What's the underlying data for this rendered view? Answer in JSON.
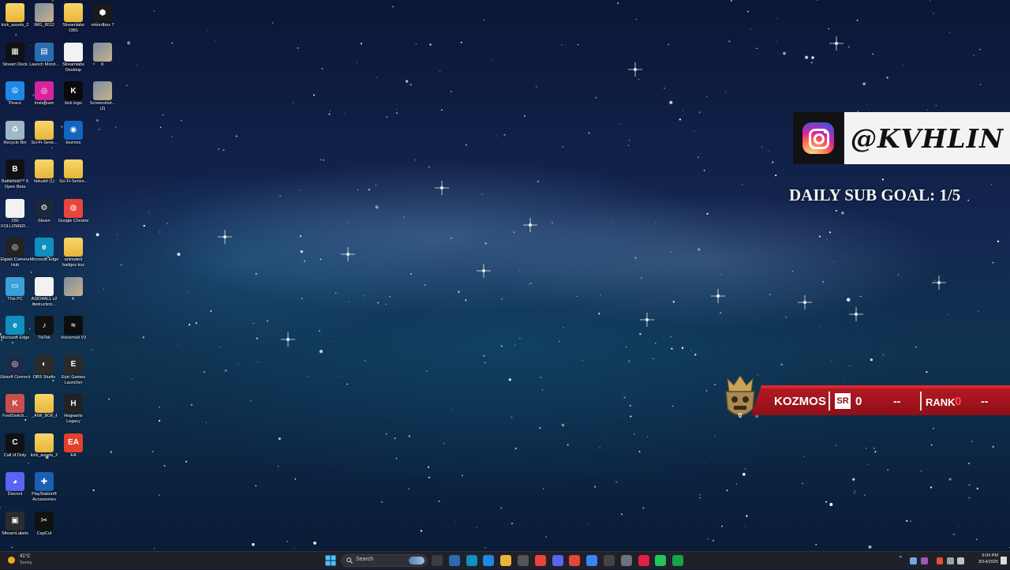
{
  "desktop_icons": [
    {
      "label": "kick_assets_2",
      "kind": "folder"
    },
    {
      "label": "IMG_8012",
      "kind": "photo"
    },
    {
      "label": "Streamlabs OBS",
      "kind": "folder"
    },
    {
      "label": "rekordbox 7",
      "kind": "app",
      "color": "#1a1a1a",
      "glyph": "⬢"
    },
    {
      "label": "Stream Deck",
      "kind": "app",
      "color": "#111",
      "glyph": "▦"
    },
    {
      "label": "Launch Monit...",
      "kind": "app",
      "color": "#2b6cb0",
      "glyph": "▤"
    },
    {
      "label": "Streamlabs Desktop",
      "kind": "file"
    },
    {
      "label": "K",
      "kind": "photo"
    },
    {
      "label": "Peace",
      "kind": "app",
      "color": "#1e88e5",
      "glyph": "☮"
    },
    {
      "label": "Instagram",
      "kind": "app",
      "color": "#d6249f",
      "glyph": "◎"
    },
    {
      "label": "kick logo",
      "kind": "app",
      "color": "#0a0a0a",
      "glyph": "K"
    },
    {
      "label": "Screenshot... (2)",
      "kind": "photo"
    },
    {
      "label": "Recycle Bin",
      "kind": "app",
      "color": "#9fb7c9",
      "glyph": "♻"
    },
    {
      "label": "Sci-Fi-Serie...",
      "kind": "folder"
    },
    {
      "label": "kozmos",
      "kind": "app",
      "color": "#1565c0",
      "glyph": "◉"
    },
    {
      "label": "",
      "kind": "none"
    },
    {
      "label": "Battlefield™ 6 Open Beta",
      "kind": "app",
      "color": "#111",
      "glyph": "B"
    },
    {
      "label": "hidusbf (1)",
      "kind": "folder"
    },
    {
      "label": "Sci-Fi-Series...",
      "kind": "folder"
    },
    {
      "label": "",
      "kind": "none"
    },
    {
      "label": "250 FOLLOWER...",
      "kind": "file"
    },
    {
      "label": "Steam",
      "kind": "app",
      "color": "#1b2838",
      "glyph": "⚙"
    },
    {
      "label": "Google Chrome",
      "kind": "app",
      "color": "#e8453c",
      "glyph": "◍"
    },
    {
      "label": "",
      "kind": "none"
    },
    {
      "label": "Elgato Camera Hub",
      "kind": "app",
      "color": "#222",
      "glyph": "◎"
    },
    {
      "label": "Microsoft Edge",
      "kind": "app",
      "color": "#0f8fbf",
      "glyph": "e"
    },
    {
      "label": "animated badges koz",
      "kind": "folder"
    },
    {
      "label": "",
      "kind": "none"
    },
    {
      "label": "This PC",
      "kind": "app",
      "color": "#3aa0d8",
      "glyph": "▭"
    },
    {
      "label": "ASIO4ALL v2 Instruction...",
      "kind": "file"
    },
    {
      "label": "K",
      "kind": "photo"
    },
    {
      "label": "",
      "kind": "none"
    },
    {
      "label": "Microsoft Edge",
      "kind": "app",
      "color": "#0f8fbf",
      "glyph": "e"
    },
    {
      "label": "TikTok",
      "kind": "app",
      "color": "#111",
      "glyph": "♪"
    },
    {
      "label": "Voicemod V3",
      "kind": "app",
      "color": "#0d0d0d",
      "glyph": "≈"
    },
    {
      "label": "",
      "kind": "none"
    },
    {
      "label": "Ubisoft Connect",
      "kind": "app",
      "color": "#1d2b4a",
      "glyph": "◎"
    },
    {
      "label": "OBS Studio",
      "kind": "app",
      "color": "#2b2b2b",
      "glyph": "◐"
    },
    {
      "label": "Epic Games Launcher",
      "kind": "app",
      "color": "#2a2a2a",
      "glyph": "E"
    },
    {
      "label": "",
      "kind": "none"
    },
    {
      "label": "FootSwitch...",
      "kind": "app",
      "color": "#c94f4f",
      "glyph": "K"
    },
    {
      "label": "_AIW_BO6_f",
      "kind": "folder"
    },
    {
      "label": "Hogwarts Legacy",
      "kind": "app",
      "color": "#222",
      "glyph": "H"
    },
    {
      "label": "",
      "kind": "none"
    },
    {
      "label": "Call of Duty",
      "kind": "app",
      "color": "#111",
      "glyph": "C"
    },
    {
      "label": "kick_assets_2",
      "kind": "folder"
    },
    {
      "label": "EA",
      "kind": "app",
      "color": "#e3402b",
      "glyph": "EA"
    },
    {
      "label": "",
      "kind": "none"
    },
    {
      "label": "Discord",
      "kind": "app",
      "color": "#5865f2",
      "glyph": "◕"
    },
    {
      "label": "PlayStation® Accessories",
      "kind": "app",
      "color": "#1a5fb4",
      "glyph": "✚"
    },
    {
      "label": "",
      "kind": "none"
    },
    {
      "label": "",
      "kind": "none"
    },
    {
      "label": "StreamLabels",
      "kind": "app",
      "color": "#2c2c2c",
      "glyph": "▣"
    },
    {
      "label": "CapCut",
      "kind": "app",
      "color": "#111",
      "glyph": "✂"
    }
  ],
  "overlay": {
    "instagram_handle": "@KVHLIN",
    "sub_goal": "DAILY SUB GOAL: 1/5",
    "player_name": "KOZMOS",
    "sr_badge": "SR",
    "sr_value": "0",
    "sr_delta": "--",
    "rank_label": "RANK",
    "rank_value": "0",
    "rank_delta": "--",
    "crest_number": "0"
  },
  "taskbar": {
    "weather_temp": "41°C",
    "weather_desc": "Sunny",
    "search_placeholder": "Search",
    "time": "6:04 PM",
    "date": "8/14/2025"
  },
  "colors": {
    "accent_red": "#b81a22",
    "taskbar_bg": "#1f2128"
  }
}
